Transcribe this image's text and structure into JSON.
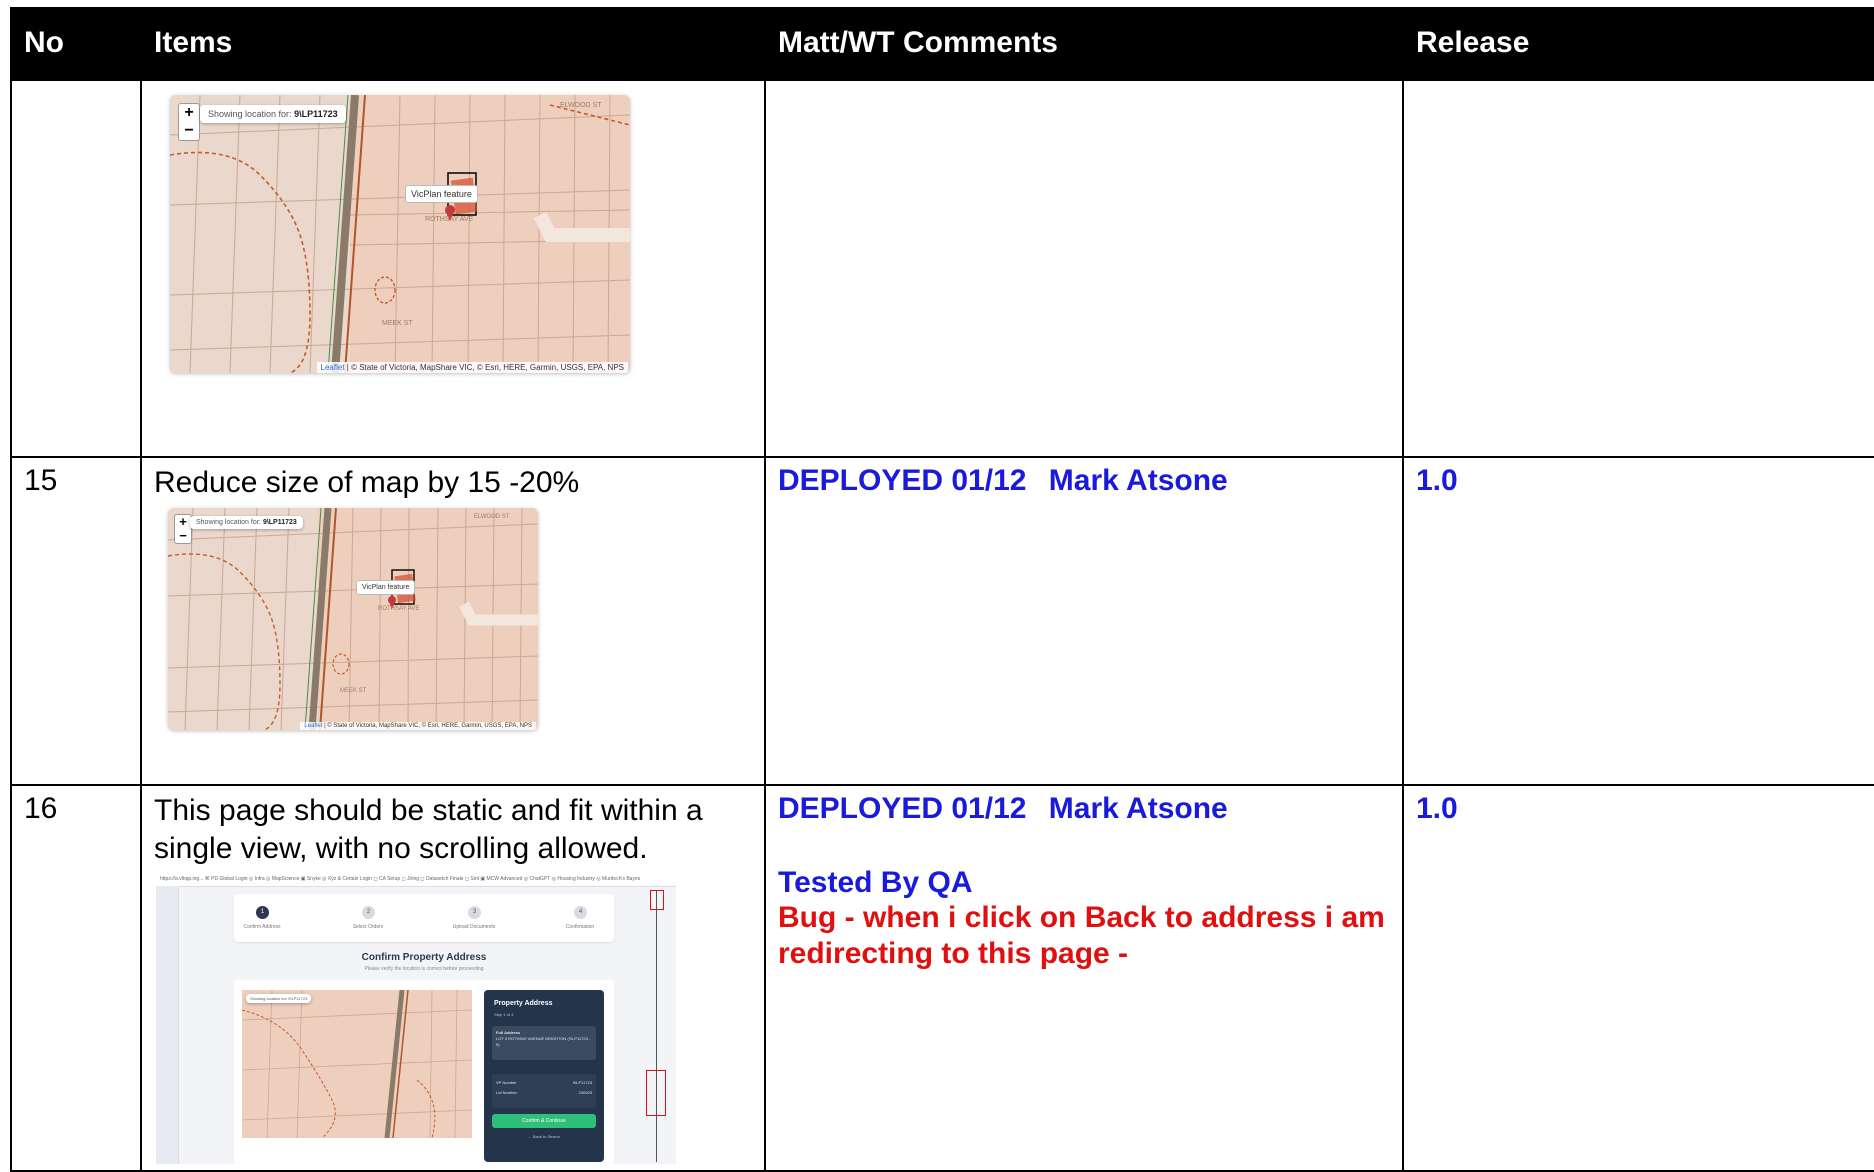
{
  "table": {
    "headers": {
      "no": "No",
      "items": "Items",
      "comments": "Matt/WT Comments",
      "release": "Release"
    },
    "map_large": {
      "zoom_in": "+",
      "zoom_out": "−",
      "location_prefix": "Showing location for:",
      "location_value": "9\\LP11723",
      "tooltip": "VicPlan feature",
      "attribution_leaflet": "Leaflet",
      "attribution": "| © State of Victoria, MapShare VIC, © Esri, HERE, Garmin, USGS, EPA, NPS",
      "street_top": "ELWOOD ST",
      "street_mid": "ROTHSAY AVE",
      "street_low": "MEEK ST"
    },
    "rows": [
      {
        "no": "15",
        "item": "Reduce size of map by 15 -20%",
        "status": "DEPLOYED",
        "date": "01/12",
        "person": "Mark Atsone",
        "release": "1.0",
        "map": {
          "zoom_in": "+",
          "zoom_out": "−",
          "location_prefix": "Showing location for:",
          "location_value": "9\\LP11723",
          "tooltip": "VicPlan feature",
          "attribution_leaflet": "Leaflet",
          "attribution": "| © State of Victoria, MapShare VIC, © Esri, HERE, Garmin, USGS, EPA, NPS",
          "street_top": "ELWOOD ST",
          "street_mid": "ROTHSAY AVE",
          "street_low": "MEEK ST"
        }
      },
      {
        "no": "16",
        "item": "This page should be static and fit within a single view, with no scrolling allowed.",
        "status": "DEPLOYED",
        "date": "01/12",
        "person": "Mark Atsone",
        "release": "1.0",
        "qa": "Tested By QA",
        "bug": "Bug - when i click on Back to address i am redirecting to this page -",
        "app": {
          "bookmarks": "https://a.vtkpp.ing... ⌘ PD Global Login ◎ Infra ◎ MapScience ▣ Snyke ◎ Xyz & Certain Login ◻ CA Setup ◻ Jiring ◻ Datasetch Finale ◻ Sint ▣ MCW Advanced ◎ ChatGPT ◎ Housing Industry ◎ Murdoch's Bayes",
          "steps": [
            "Confirm Address",
            "Select Orders",
            "Upload Documents",
            "Confirmation"
          ],
          "step_numbers": [
            "1",
            "2",
            "3",
            "4"
          ],
          "title": "Confirm Property Address",
          "subtitle": "Please verify the location is correct before proceeding",
          "panel_title": "Property Address",
          "panel_step": "Step 1 of 4",
          "full_address_label": "Full Address",
          "full_address": "LOT 9 ROTHSAY AVENUE BRIGHTON (9\\LP11723 - 9)",
          "vp_label": "VP Number",
          "vp_value": "9\\LP11723",
          "lot_label": "Lot Number",
          "lot_value": "230929",
          "confirm_button": "Confirm & Continue",
          "back_link": "← Back to Search",
          "mini_location": "Showing location for: 9\\LP11723"
        }
      }
    ]
  },
  "colors": {
    "header_bg": "#000000",
    "status_blue": "#1a1adb",
    "bug_red": "#e01010",
    "map_base": "#eecfbd"
  }
}
